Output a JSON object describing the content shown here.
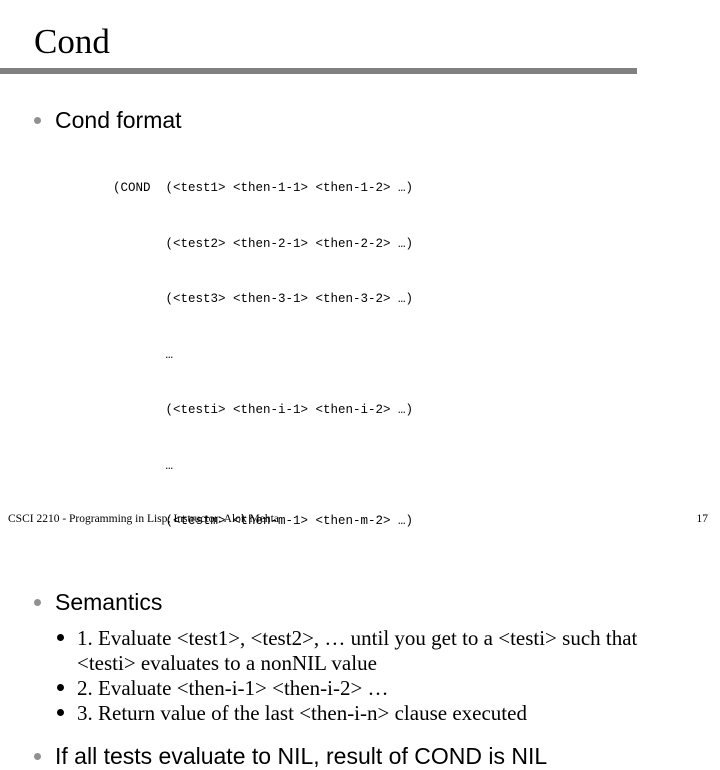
{
  "slide": {
    "title": "Cond",
    "rule_color": "#808080",
    "bullet_level1_color": "#919191",
    "bullet_level2_color": "#000000"
  },
  "content": {
    "bullet_cond_format": "Cond format",
    "code": {
      "lines": [
        "(COND  (<test1> <then-1-1> <then-1-2> …)",
        "       (<test2> <then-2-1> <then-2-2> …)",
        "       (<test3> <then-3-1> <then-3-2> …)",
        "       …",
        "       (<testi> <then-i-1> <then-i-2> …)",
        "       …",
        "       (<testm> <then-m-1> <then-m-2> …)"
      ]
    },
    "bullet_semantics": "Semantics",
    "semantics_steps": [
      "1. Evaluate <test1>, <test2>, … until you get to a <testi> such that <testi> evaluates to a nonNIL value",
      "2. Evaluate <then-i-1> <then-i-2> …",
      "3. Return value of the last <then-i-n> clause executed"
    ],
    "bullet_all_nil": "If all tests evaluate to NIL, result of COND is NIL"
  },
  "footer": {
    "course": "CSCI 2210 - Programming in Lisp; Instructor: Alok Mehta",
    "page_number": "17"
  }
}
